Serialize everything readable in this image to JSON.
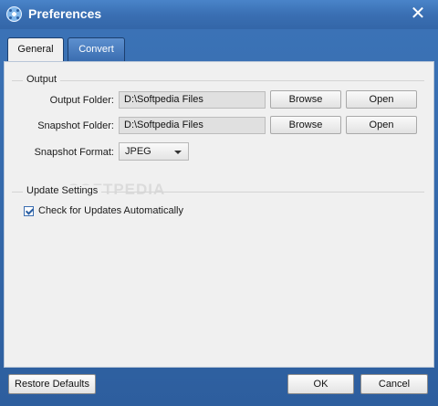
{
  "window": {
    "title": "Preferences",
    "app_icon": "film-reel-icon",
    "close_icon": "close-icon"
  },
  "tabs": [
    {
      "label": "General",
      "active": true
    },
    {
      "label": "Convert",
      "active": false
    }
  ],
  "output": {
    "group_title": "Output",
    "output_folder": {
      "label": "Output Folder:",
      "value": "D:\\Softpedia Files",
      "browse_label": "Browse",
      "open_label": "Open"
    },
    "snapshot_folder": {
      "label": "Snapshot Folder:",
      "value": "D:\\Softpedia Files",
      "browse_label": "Browse",
      "open_label": "Open"
    },
    "snapshot_format": {
      "label": "Snapshot Format:",
      "selected": "JPEG"
    }
  },
  "update_settings": {
    "group_title": "Update Settings",
    "auto_check": {
      "label": "Check for Updates Automatically",
      "checked": true
    }
  },
  "footer": {
    "restore_label": "Restore Defaults",
    "ok_label": "OK",
    "cancel_label": "Cancel"
  },
  "watermark": "SOFTPEDIA",
  "colors": {
    "titlebar": "#3a6fb3",
    "panel": "#f0f0f0",
    "accent": "#2a5ea1"
  }
}
